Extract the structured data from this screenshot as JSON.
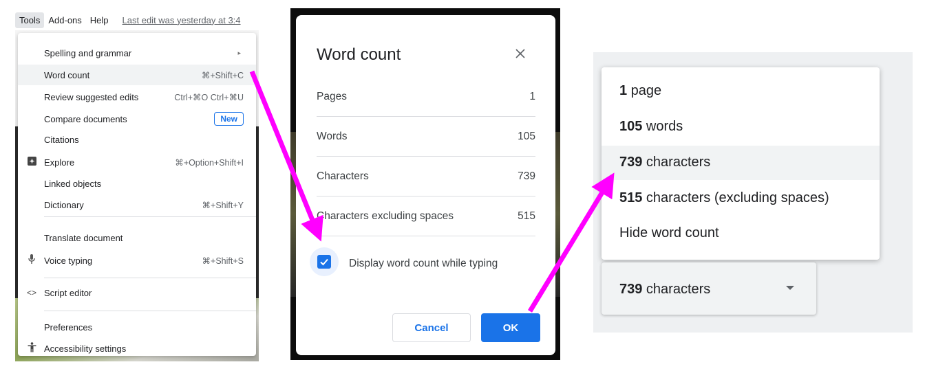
{
  "menubar": {
    "items": [
      "Tools",
      "Add-ons",
      "Help"
    ],
    "last_edit": "Last edit was yesterday at 3:4"
  },
  "tools_menu": {
    "items": [
      {
        "label": "Spelling and grammar",
        "shortcut": "",
        "icon": "",
        "submenu_arrow": "▸"
      },
      {
        "label": "Word count",
        "shortcut": "⌘+Shift+C",
        "icon": ""
      },
      {
        "label": "Review suggested edits",
        "shortcut": "Ctrl+⌘O Ctrl+⌘U",
        "icon": ""
      },
      {
        "label": "Compare documents",
        "badge": "New",
        "icon": ""
      },
      {
        "label": "Citations",
        "shortcut": "",
        "icon": ""
      },
      {
        "label": "Explore",
        "shortcut": "⌘+Option+Shift+I",
        "icon": "explore-icon"
      },
      {
        "label": "Linked objects",
        "shortcut": "",
        "icon": ""
      },
      {
        "label": "Dictionary",
        "shortcut": "⌘+Shift+Y",
        "icon": ""
      },
      {
        "label": "Translate document",
        "shortcut": "",
        "icon": ""
      },
      {
        "label": "Voice typing",
        "shortcut": "⌘+Shift+S",
        "icon": "microphone-icon"
      },
      {
        "label": "Script editor",
        "shortcut": "",
        "icon": "code-brackets-icon"
      },
      {
        "label": "Preferences",
        "shortcut": "",
        "icon": ""
      },
      {
        "label": "Accessibility settings",
        "shortcut": "",
        "icon": "accessibility-icon"
      }
    ]
  },
  "dialog": {
    "title": "Word count",
    "close_icon": "close-icon",
    "rows": [
      {
        "label": "Pages",
        "value": "1"
      },
      {
        "label": "Words",
        "value": "105"
      },
      {
        "label": "Characters",
        "value": "739"
      },
      {
        "label": "Characters excluding spaces",
        "value": "515"
      }
    ],
    "checkbox_label": "Display word count while typing",
    "checkbox_checked": true,
    "cancel_label": "Cancel",
    "ok_label": "OK",
    "accent_color": "#1a73e8"
  },
  "wc_dropdown": {
    "options": [
      {
        "num": "1",
        "rest": " page"
      },
      {
        "num": "105",
        "rest": " words"
      },
      {
        "num": "739",
        "rest": " characters"
      },
      {
        "num": "515",
        "rest": " characters (excluding spaces)"
      },
      {
        "num": "",
        "rest": "Hide word count"
      }
    ],
    "selected": {
      "num": "739",
      "rest": " characters"
    },
    "caret_icon": "caret-down-icon"
  },
  "arrow_color": "#ff00ff"
}
